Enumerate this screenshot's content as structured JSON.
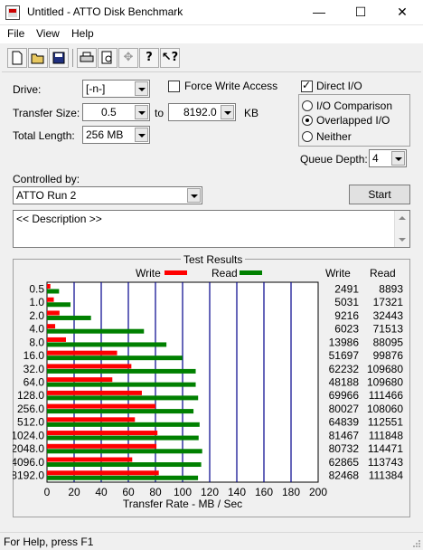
{
  "window": {
    "title": "Untitled - ATTO Disk Benchmark"
  },
  "menu": {
    "items": [
      "File",
      "View",
      "Help"
    ]
  },
  "toolbar": {
    "icons": [
      "new-file-icon",
      "open-folder-icon",
      "save-icon",
      "print-icon",
      "print-preview-icon",
      "move-icon",
      "help-icon",
      "context-help-icon"
    ]
  },
  "form": {
    "drive_label": "Drive:",
    "drive_value": "[-n-]",
    "transfer_size_label": "Transfer Size:",
    "transfer_from": "0.5",
    "to_label": "to",
    "transfer_to": "8192.0",
    "kb_label": "KB",
    "total_length_label": "Total Length:",
    "total_length_value": "256 MB",
    "force_write_label": "Force Write Access",
    "force_write_checked": false,
    "direct_io_label": "Direct I/O",
    "direct_io_checked": true,
    "io_comparison_label": "I/O Comparison",
    "overlapped_io_label": "Overlapped I/O",
    "neither_label": "Neither",
    "selected_mode": "overlapped",
    "queue_depth_label": "Queue Depth:",
    "queue_depth_value": "4",
    "controlled_by_label": "Controlled by:",
    "controlled_by_value": "ATTO Run 2",
    "start_label": "Start",
    "description": "<< Description >>"
  },
  "results": {
    "group_title": "Test Results",
    "write_label": "Write",
    "read_label": "Read",
    "col_write": "Write",
    "col_read": "Read"
  },
  "chart_data": {
    "type": "bar",
    "xlabel": "Transfer Rate - MB / Sec",
    "xlim": [
      0,
      200
    ],
    "xticks": [
      0,
      20,
      40,
      60,
      80,
      100,
      120,
      140,
      160,
      180,
      200
    ],
    "categories": [
      "0.5",
      "1.0",
      "2.0",
      "4.0",
      "8.0",
      "16.0",
      "32.0",
      "64.0",
      "128.0",
      "256.0",
      "512.0",
      "1024.0",
      "2048.0",
      "4096.0",
      "8192.0"
    ],
    "series": [
      {
        "name": "Write",
        "color": "#ff0000",
        "values": [
          2491,
          5031,
          9216,
          6023,
          13986,
          51697,
          62232,
          48188,
          69966,
          80027,
          64839,
          81467,
          80732,
          62865,
          82468
        ]
      },
      {
        "name": "Read",
        "color": "#008000",
        "values": [
          8893,
          17321,
          32443,
          71513,
          88095,
          99876,
          109680,
          109680,
          111466,
          108060,
          112551,
          111848,
          114471,
          113743,
          111384
        ]
      }
    ],
    "units_note": "values in KB/s; plotted as MB/s"
  },
  "status": {
    "text": "For Help, press F1"
  }
}
